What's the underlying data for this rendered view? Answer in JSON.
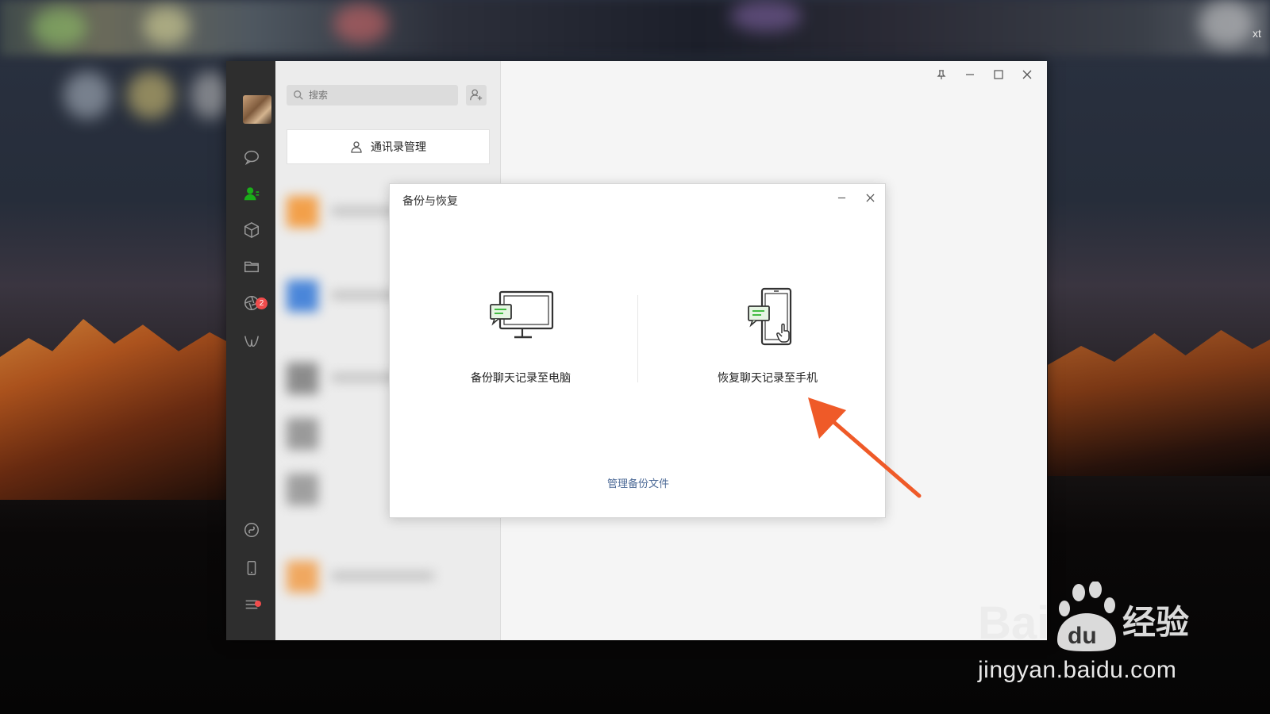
{
  "desktop": {
    "corner_text": "xt"
  },
  "app": {
    "search": {
      "placeholder": "搜索"
    },
    "contacts_manage_label": "通讯录管理",
    "sidebar_badge_count": "2"
  },
  "dialog": {
    "title": "备份与恢复",
    "option_backup_label": "备份聊天记录至电脑",
    "option_restore_label": "恢复聊天记录至手机",
    "manage_link": "管理备份文件"
  },
  "watermark": {
    "brand": "Baidu经验",
    "url": "jingyan.baidu.com"
  },
  "colors": {
    "accent_green": "#1aad19",
    "link_blue": "#4b6996",
    "arrow_orange": "#ef5a28",
    "badge_red": "#f04c4c"
  }
}
